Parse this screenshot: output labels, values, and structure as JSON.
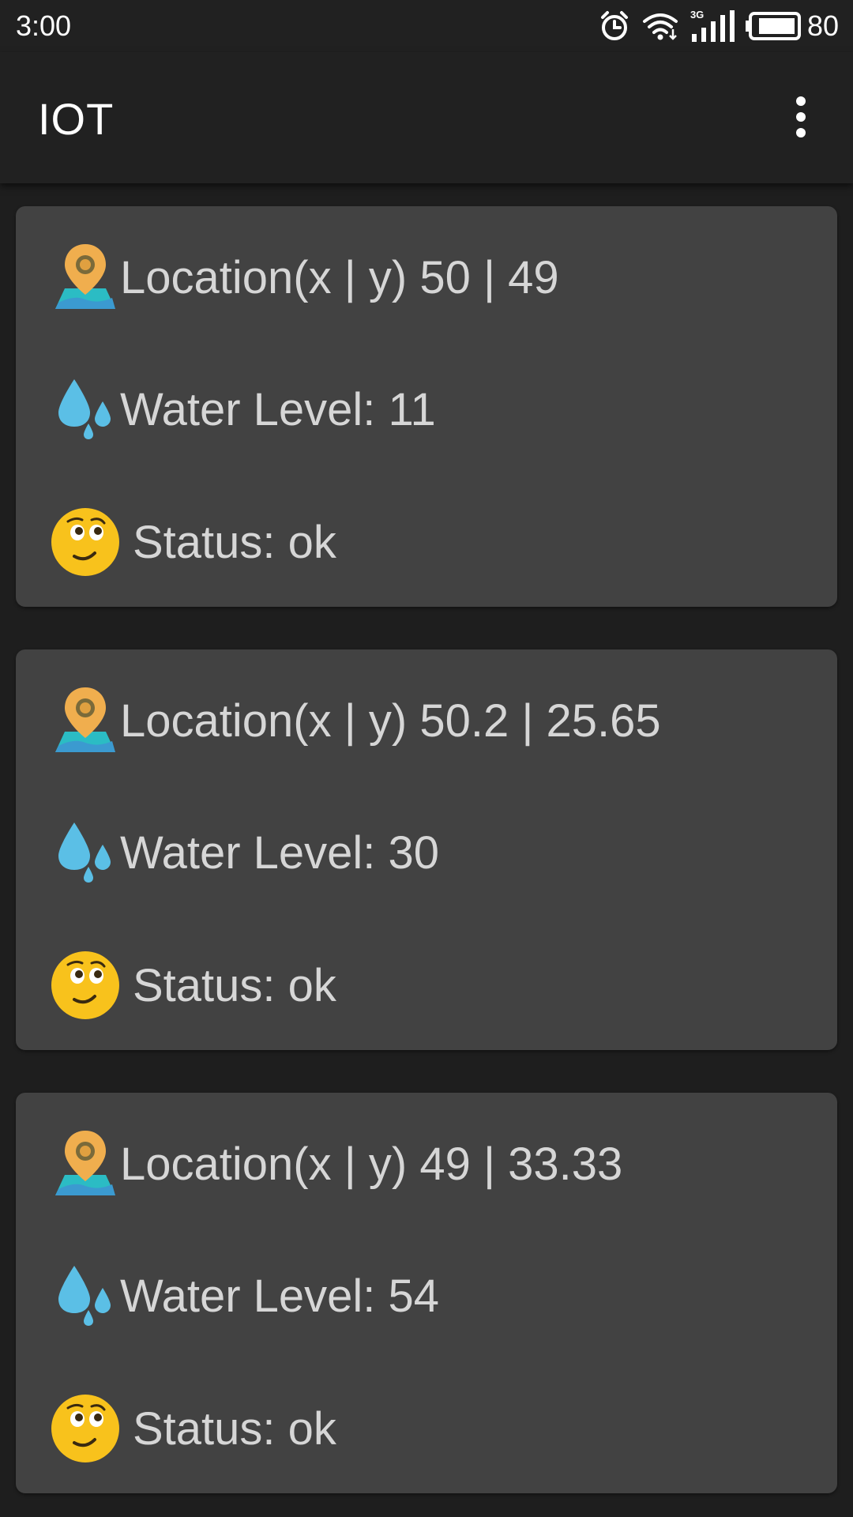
{
  "status_bar": {
    "time": "3:00",
    "network_type": "3G",
    "battery_percent": "80",
    "icons": [
      "alarm-icon",
      "wifi-icon",
      "cellular-signal-icon",
      "battery-icon"
    ]
  },
  "app_bar": {
    "title": "IOT",
    "overflow_icon": "more-vert-icon"
  },
  "colors": {
    "background": "#1e1e1e",
    "app_bar": "#212121",
    "card": "#424242",
    "text": "#d6d6d6",
    "pin": "#f0ae4e",
    "water": "#5bbfe6",
    "emoji": "#f8c21c"
  },
  "cards": [
    {
      "location_text": "Location(x | y) 50 | 49",
      "water_text": "Water Level: 11",
      "status_text": "Status: ok",
      "location_icon": "map-pin-icon",
      "water_icon": "water-drops-icon",
      "status_icon": "face-emoji-icon"
    },
    {
      "location_text": "Location(x | y) 50.2 | 25.65",
      "water_text": "Water Level: 30",
      "status_text": "Status: ok",
      "location_icon": "map-pin-icon",
      "water_icon": "water-drops-icon",
      "status_icon": "face-emoji-icon"
    },
    {
      "location_text": "Location(x | y) 49 | 33.33",
      "water_text": "Water Level: 54",
      "status_text": "Status: ok",
      "location_icon": "map-pin-icon",
      "water_icon": "water-drops-icon",
      "status_icon": "face-emoji-icon"
    }
  ]
}
